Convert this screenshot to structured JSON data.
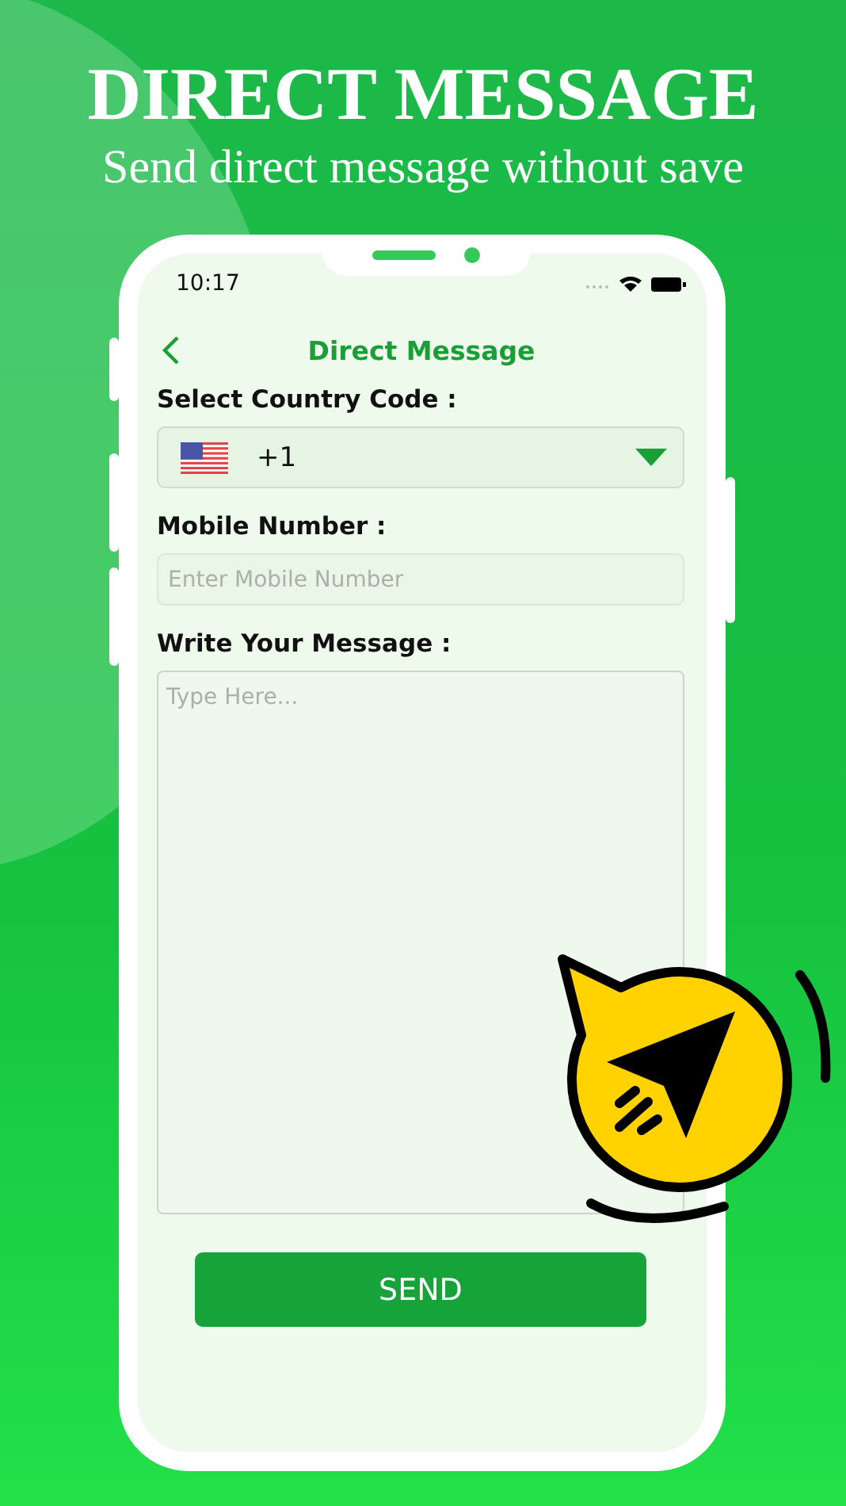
{
  "header": {
    "title": "DIRECT MESSAGE",
    "subtitle": "Send direct message without save"
  },
  "status_bar": {
    "time": "10:17"
  },
  "nav": {
    "title": "Direct Message"
  },
  "country_code": {
    "label": "Select Country Code :",
    "value": "+1"
  },
  "mobile_number": {
    "label": "Mobile Number :",
    "placeholder": "Enter Mobile Number"
  },
  "message": {
    "label": "Write Your Message :",
    "placeholder": "Type Here..."
  },
  "send_button": {
    "label": "SEND"
  }
}
